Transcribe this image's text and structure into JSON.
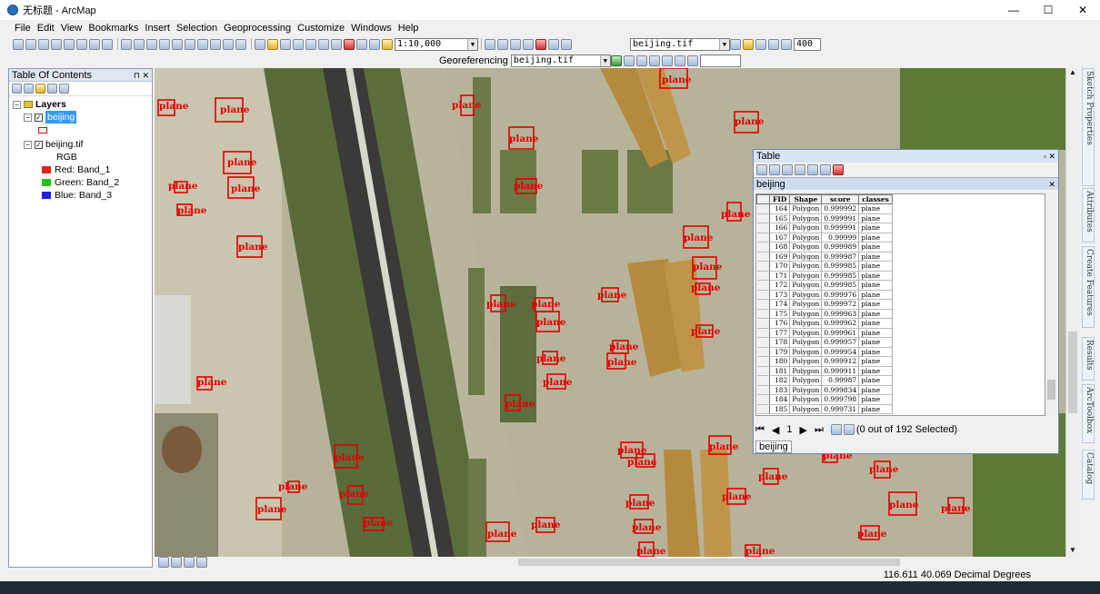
{
  "window": {
    "title": "无标题 - ArcMap",
    "minimize": "—",
    "maximize": "☐",
    "close": "✕"
  },
  "menu": [
    "File",
    "Edit",
    "View",
    "Bookmarks",
    "Insert",
    "Selection",
    "Geoprocessing",
    "Customize",
    "Windows",
    "Help"
  ],
  "toolbar": {
    "scale": "1:10,000",
    "layer_combo": "beijing.tif",
    "zoom_value": "400",
    "georef_label": "Georeferencing",
    "georef_layer": "beijing.tif"
  },
  "toc": {
    "title": "Table Of Contents",
    "layers_label": "Layers",
    "layer1": "beijing",
    "layer2": "beijing.tif",
    "rgb_label": "RGB",
    "bands": [
      {
        "label": "Red:",
        "band": "Band_1",
        "color": "#e02020"
      },
      {
        "label": "Green:",
        "band": "Band_2",
        "color": "#20c020"
      },
      {
        "label": "Blue:",
        "band": "Band_3",
        "color": "#2020e0"
      }
    ]
  },
  "map": {
    "detection_label": "plane"
  },
  "table": {
    "title": "Table",
    "layer_tab": "beijing",
    "columns": [
      "FID",
      "Shape",
      "score",
      "classes"
    ],
    "rows": [
      [
        "164",
        "Polygon",
        "0.999992",
        "plane"
      ],
      [
        "165",
        "Polygon",
        "0.999991",
        "plane"
      ],
      [
        "166",
        "Polygon",
        "0.999991",
        "plane"
      ],
      [
        "167",
        "Polygon",
        "0.99999",
        "plane"
      ],
      [
        "168",
        "Polygon",
        "0.999989",
        "plane"
      ],
      [
        "169",
        "Polygon",
        "0.999987",
        "plane"
      ],
      [
        "170",
        "Polygon",
        "0.999985",
        "plane"
      ],
      [
        "171",
        "Polygon",
        "0.999985",
        "plane"
      ],
      [
        "172",
        "Polygon",
        "0.999985",
        "plane"
      ],
      [
        "173",
        "Polygon",
        "0.999976",
        "plane"
      ],
      [
        "174",
        "Polygon",
        "0.999972",
        "plane"
      ],
      [
        "175",
        "Polygon",
        "0.999963",
        "plane"
      ],
      [
        "176",
        "Polygon",
        "0.999962",
        "plane"
      ],
      [
        "177",
        "Polygon",
        "0.999961",
        "plane"
      ],
      [
        "178",
        "Polygon",
        "0.999957",
        "plane"
      ],
      [
        "179",
        "Polygon",
        "0.999954",
        "plane"
      ],
      [
        "180",
        "Polygon",
        "0.999912",
        "plane"
      ],
      [
        "181",
        "Polygon",
        "0.999911",
        "plane"
      ],
      [
        "182",
        "Polygon",
        "0.99987",
        "plane"
      ],
      [
        "183",
        "Polygon",
        "0.999834",
        "plane"
      ],
      [
        "184",
        "Polygon",
        "0.999798",
        "plane"
      ],
      [
        "185",
        "Polygon",
        "0.999731",
        "plane"
      ]
    ],
    "record_value": "1",
    "selection_status": "(0 out of 192 Selected)",
    "bottom_tab": "beijing"
  },
  "side_tabs": [
    "Sketch Properties",
    "Attributes",
    "Create Features",
    "Results",
    "ArcToolbox",
    "Catalog"
  ],
  "status": {
    "coords": "116.611  40.069 Decimal Degrees"
  }
}
